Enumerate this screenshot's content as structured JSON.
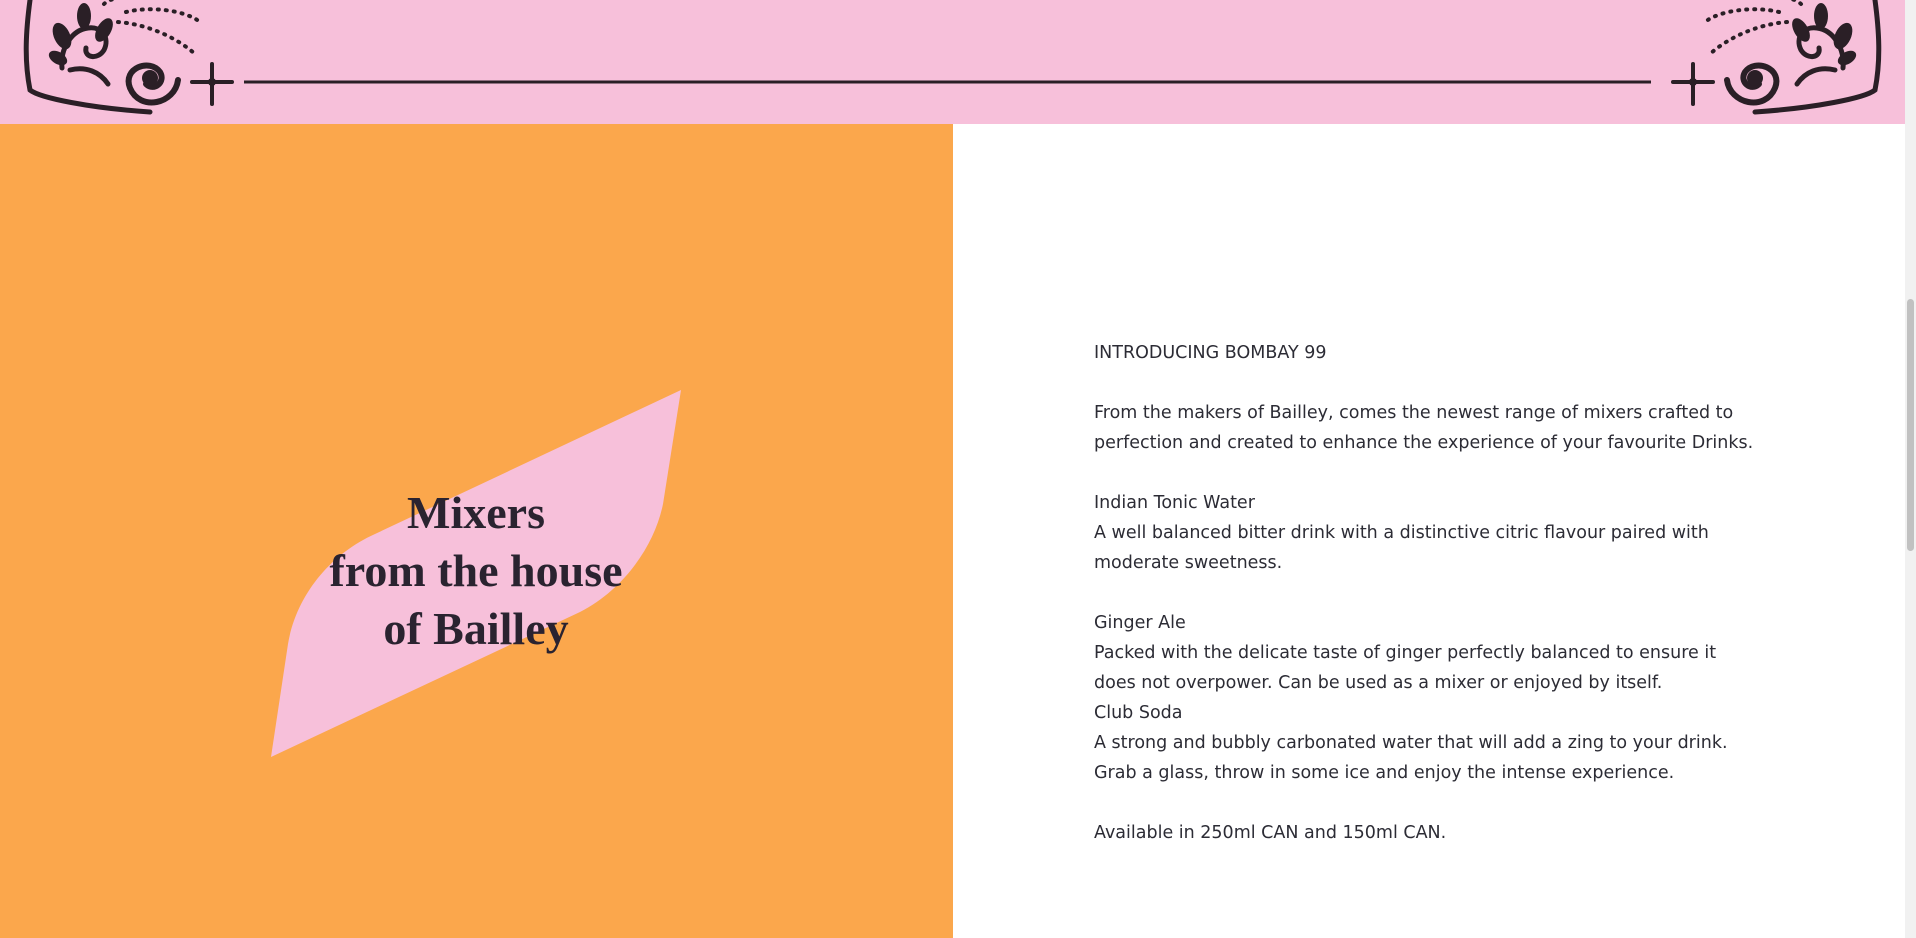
{
  "colors": {
    "banner": "#f7c0da",
    "left_panel": "#fba74c",
    "leaf": "#f7c0da",
    "ornament": "#2a1f26",
    "text": "#2c2c35"
  },
  "icons": [
    "left-ornament-icon",
    "right-ornament-icon",
    "leaf-shape-icon"
  ],
  "hero": {
    "line1": "Mixers",
    "line2": "from the house",
    "line3": "of Bailley"
  },
  "intro": {
    "heading": "INTRODUCING BOMBAY 99",
    "description": "From the makers of Bailley, comes the newest range of mixers crafted to perfection and created to enhance the experience of your favourite Drinks."
  },
  "products": [
    {
      "name": "Indian Tonic Water",
      "description": "A well balanced bitter drink with a distinctive citric flavour paired with moderate sweetness."
    },
    {
      "name": "Ginger Ale",
      "description": "Packed with the delicate taste of ginger perfectly balanced to ensure it does not overpower. Can be used as a mixer or enjoyed by itself."
    },
    {
      "name": "Club Soda",
      "description": "A strong and bubbly carbonated water that will add a zing to your drink. Grab a glass, throw in some ice and enjoy the intense experience."
    }
  ],
  "availability": "Available in 250ml CAN and 150ml CAN."
}
